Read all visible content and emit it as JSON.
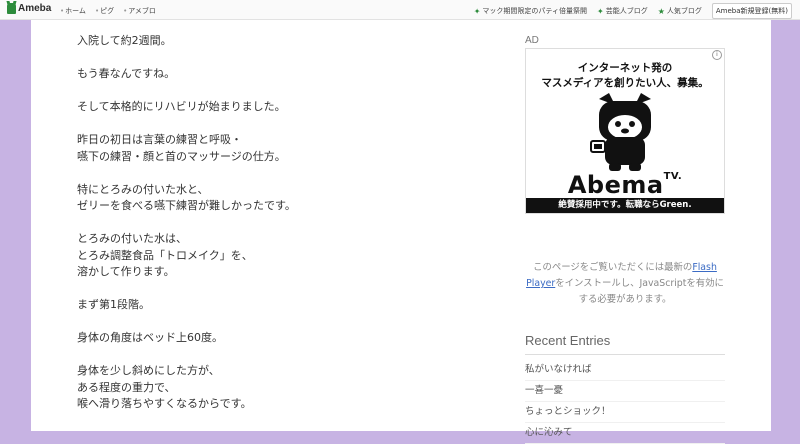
{
  "topbar": {
    "logo": "Ameba",
    "nav": [
      "ホーム",
      "ピグ",
      "アメブロ"
    ],
    "links": [
      "マック期間限定のパティ倍量祭開",
      "芸能人ブログ",
      "人気ブログ"
    ],
    "register": "Ameba新規登録(無料)"
  },
  "article": {
    "lines": [
      "入院して約2週間。",
      "もう春なんですね。",
      "そして本格的にリハビリが始まりました。",
      "昨日の初日は言葉の練習と呼吸・",
      "嚥下の練習・顔と首のマッサージの仕方。",
      "特にとろみの付いた水と、",
      "ゼリーを食べる嚥下練習が難しかったです。",
      "とろみの付いた水は、",
      "とろみ調整食品「トロメイク」を、",
      "溶かして作ります。",
      "まず第1段階。",
      "身体の角度はベッド上60度。",
      "身体を少し斜めにした方が、",
      "ある程度の重力で、",
      "喉へ滑り落ちやすくなるからです。"
    ]
  },
  "sidebar": {
    "ad_label": "AD",
    "ad": {
      "headline1": "インターネット発の",
      "headline2": "マスメディアを創りたい人、募集。",
      "brand": "Abema",
      "brand_suffix": "TV.",
      "footer": "絶賛採用中です。転職ならGreen."
    },
    "flash": {
      "before": "このページをご覧いただくには最新の",
      "link": "Flash Player",
      "after": "をインストールし、JavaScriptを有効にする必要があります。"
    },
    "recent_title": "Recent Entries",
    "recent": [
      "私がいなければ",
      "一喜一憂",
      "ちょっとショック！",
      "心に沁みて"
    ]
  }
}
